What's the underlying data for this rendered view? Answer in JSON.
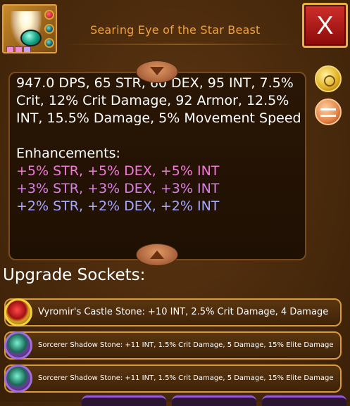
{
  "item": {
    "title": "Searing Eye of the Star Beast",
    "icon": "star-beast-eye-icon",
    "socket_colors": [
      "#b00018",
      "#1a5a66",
      "#1a5a66"
    ]
  },
  "close_label": "X",
  "stats": {
    "main": "947.0 DPS, 65 STR, 60 DEX, 95 INT, 7.5% Crit, 12% Crit Damage, 92 Armor, 12.5% INT, 15.5% Damage, 5% Movement Speed",
    "enhancements_heading": "Enhancements:",
    "enhancements": [
      {
        "text": "+5% STR, +5% DEX, +5% INT",
        "color": "#f07ad8"
      },
      {
        "text": "+3% STR, +3% DEX, +3% INT",
        "color": "#d980e8"
      },
      {
        "text": "+2% STR, +2% DEX, +2% INT",
        "color": "#a8a8ff"
      }
    ]
  },
  "upgrade": {
    "heading": "Upgrade Sockets:",
    "sockets": [
      {
        "text": "Vyromir's Castle Stone: +10 INT, 2.5% Crit Damage, 4 Damage",
        "icon": "castle-stone-icon"
      },
      {
        "text": "Sorcerer Shadow Stone: +11 INT, 1.5% Crit Damage, 5 Damage, 15% Elite Damage",
        "icon": "shadow-stone-icon"
      },
      {
        "text": "Sorcerer Shadow Stone: +11 INT, 1.5% Crit Damage, 5 Damage, 15% Elite Damage",
        "icon": "shadow-stone-icon"
      }
    ]
  }
}
